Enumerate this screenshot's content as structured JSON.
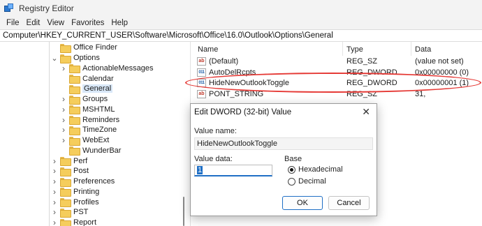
{
  "window": {
    "title": "Registry Editor"
  },
  "menu": [
    "File",
    "Edit",
    "View",
    "Favorites",
    "Help"
  ],
  "address": "Computer\\HKEY_CURRENT_USER\\Software\\Microsoft\\Office\\16.0\\Outlook\\Options\\General",
  "tree": [
    {
      "label": "Office Finder",
      "chevron": "",
      "depth": 1
    },
    {
      "label": "Options",
      "chevron": "v",
      "depth": 1
    },
    {
      "label": "ActionableMessages",
      "chevron": ">",
      "depth": 2
    },
    {
      "label": "Calendar",
      "chevron": "",
      "depth": 2
    },
    {
      "label": "General",
      "chevron": "",
      "depth": 2,
      "selected": true
    },
    {
      "label": "Groups",
      "chevron": ">",
      "depth": 2
    },
    {
      "label": "MSHTML",
      "chevron": ">",
      "depth": 2
    },
    {
      "label": "Reminders",
      "chevron": ">",
      "depth": 2
    },
    {
      "label": "TimeZone",
      "chevron": ">",
      "depth": 2
    },
    {
      "label": "WebExt",
      "chevron": ">",
      "depth": 2
    },
    {
      "label": "WunderBar",
      "chevron": "",
      "depth": 2
    },
    {
      "label": "Perf",
      "chevron": ">",
      "depth": 1
    },
    {
      "label": "Post",
      "chevron": ">",
      "depth": 1
    },
    {
      "label": "Preferences",
      "chevron": ">",
      "depth": 1
    },
    {
      "label": "Printing",
      "chevron": ">",
      "depth": 1
    },
    {
      "label": "Profiles",
      "chevron": ">",
      "depth": 1
    },
    {
      "label": "PST",
      "chevron": ">",
      "depth": 1
    },
    {
      "label": "Report",
      "chevron": ">",
      "depth": 1
    }
  ],
  "list": {
    "headers": {
      "name": "Name",
      "type": "Type",
      "data": "Data"
    },
    "rows": [
      {
        "icon": "ab",
        "name": "(Default)",
        "type": "REG_SZ",
        "data": "(value not set)"
      },
      {
        "icon": "011",
        "name": "AutoDelRcpts",
        "type": "REG_DWORD",
        "data": "0x00000000 (0)"
      },
      {
        "icon": "011",
        "name": "HideNewOutlookToggle",
        "type": "REG_DWORD",
        "data": "0x00000001 (1)"
      },
      {
        "icon": "ab",
        "name": "PONT_STRING",
        "type": "REG_SZ",
        "data": "31,"
      }
    ]
  },
  "dialog": {
    "title": "Edit DWORD (32-bit) Value",
    "close": "✕",
    "value_name_label": "Value name:",
    "value_name": "HideNewOutlookToggle",
    "value_data_label": "Value data:",
    "value_data": "1",
    "base_label": "Base",
    "hex_label": "Hexadecimal",
    "dec_label": "Decimal",
    "ok": "OK",
    "cancel": "Cancel"
  },
  "colors": {
    "highlight": "#e53935",
    "accent": "#1f6fc5"
  }
}
